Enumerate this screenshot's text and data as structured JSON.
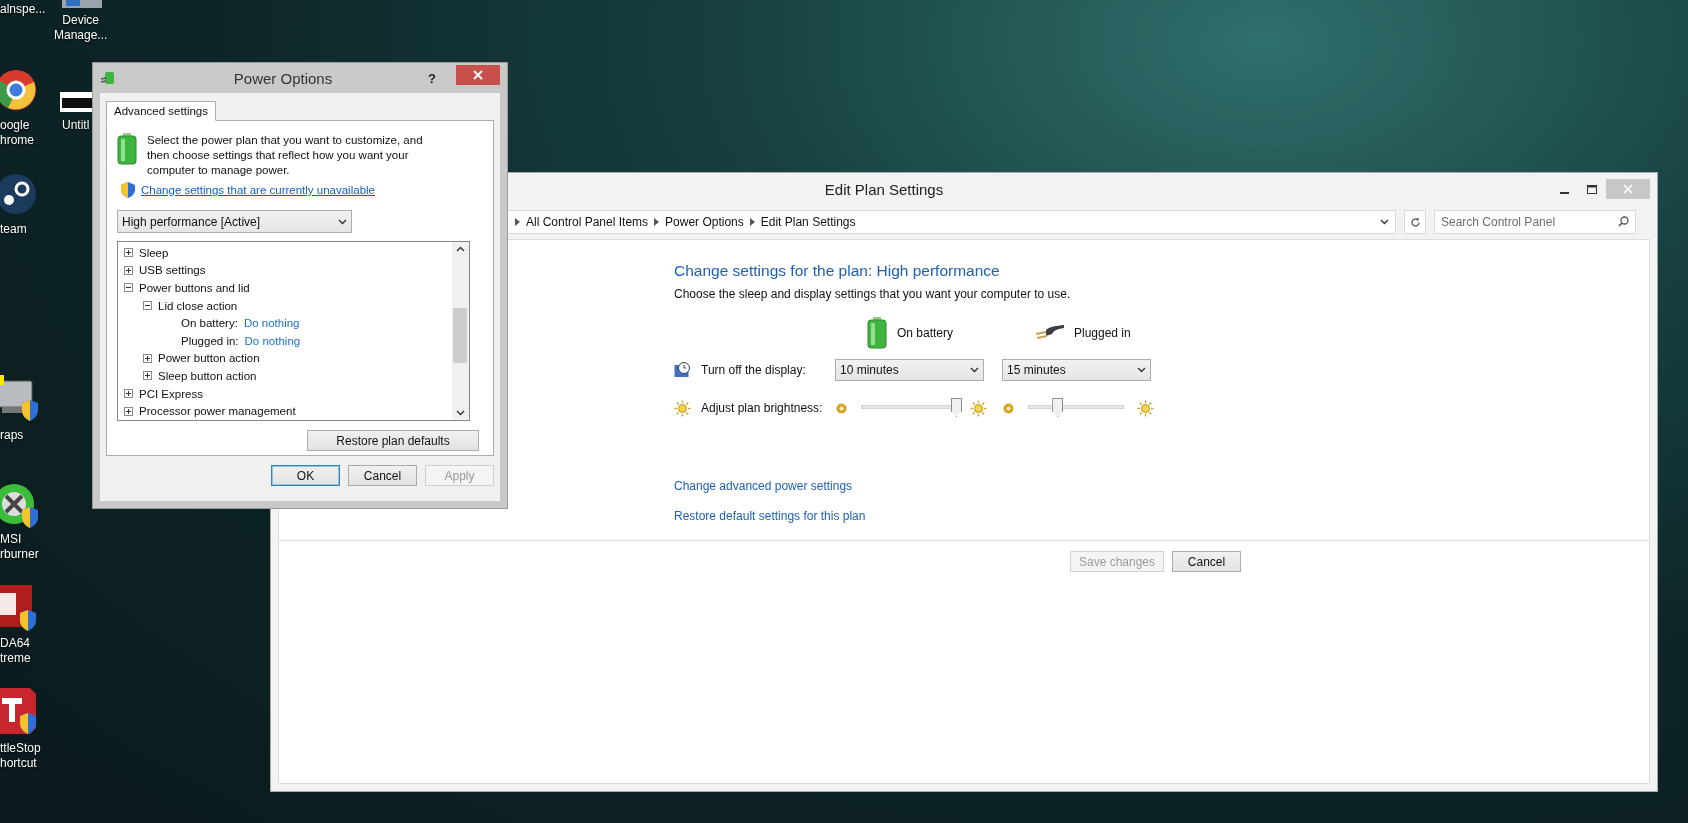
{
  "desktop_icons": [
    {
      "label": "alnspe..."
    },
    {
      "label": "oogle\nhrome"
    },
    {
      "label": "team"
    },
    {
      "label": "raps"
    },
    {
      "label": "MSI\nrburner"
    },
    {
      "label": "DA64\ntreme"
    },
    {
      "label": "ttleStop\nhortcut"
    },
    {
      "label": "Device\nManage..."
    },
    {
      "label": "Untitl"
    }
  ],
  "edit_window": {
    "title": "Edit Plan Settings",
    "breadcrumb": [
      "All Control Panel Items",
      "Power Options",
      "Edit Plan Settings"
    ],
    "search": {
      "placeholder": "Search Control Panel"
    },
    "heading": "Change settings for the plan: High performance",
    "description": "Choose the sleep and display settings that you want your computer to use.",
    "columns": [
      {
        "label": "On battery",
        "kind": "battery"
      },
      {
        "label": "Plugged in",
        "kind": "plug"
      }
    ],
    "settings": [
      {
        "kind": "dropdown",
        "label": "Turn off the display:",
        "controls": [
          {
            "value": "10 minutes"
          },
          {
            "value": "15 minutes"
          }
        ]
      },
      {
        "kind": "slider",
        "label": "Adjust plan brightness:",
        "controls": [
          {
            "level": 1
          },
          {
            "level": 0.3
          }
        ]
      }
    ],
    "links": [
      "Change advanced power settings",
      "Restore default settings for this plan"
    ],
    "buttons": [
      {
        "label": "Save changes",
        "disabled": true
      },
      {
        "label": "Cancel",
        "disabled": false
      }
    ]
  },
  "dialog": {
    "title": "Power Options",
    "help": "?",
    "tabs": [
      {
        "label": "Advanced settings",
        "selected": true
      }
    ],
    "description": "Select the power plan that you want to customize, and then choose settings that reflect how you want your computer to manage power.",
    "link": "Change settings that are currently unavailable",
    "plan_select": {
      "value": "High performance [Active]"
    },
    "tree": [
      {
        "kind": "group",
        "label": "Sleep",
        "expanded": false
      },
      {
        "kind": "group",
        "label": "USB settings",
        "expanded": false
      },
      {
        "kind": "group",
        "label": "Power buttons and lid",
        "expanded": true,
        "children": [
          {
            "kind": "group",
            "label": "Lid close action",
            "expanded": true,
            "children": [
              {
                "kind": "setting",
                "label": "On battery:",
                "value": "Do nothing"
              },
              {
                "kind": "setting",
                "label": "Plugged in:",
                "value": "Do nothing"
              }
            ]
          },
          {
            "kind": "group",
            "label": "Power button action",
            "expanded": false
          },
          {
            "kind": "group",
            "label": "Sleep button action",
            "expanded": false
          }
        ]
      },
      {
        "kind": "group",
        "label": "PCI Express",
        "expanded": false
      },
      {
        "kind": "group",
        "label": "Processor power management",
        "expanded": false
      }
    ],
    "restore_button": "Restore plan defaults",
    "buttons": [
      {
        "label": "OK",
        "default": true,
        "disabled": false
      },
      {
        "label": "Cancel",
        "default": false,
        "disabled": false
      },
      {
        "label": "Apply",
        "default": false,
        "disabled": true
      }
    ]
  }
}
